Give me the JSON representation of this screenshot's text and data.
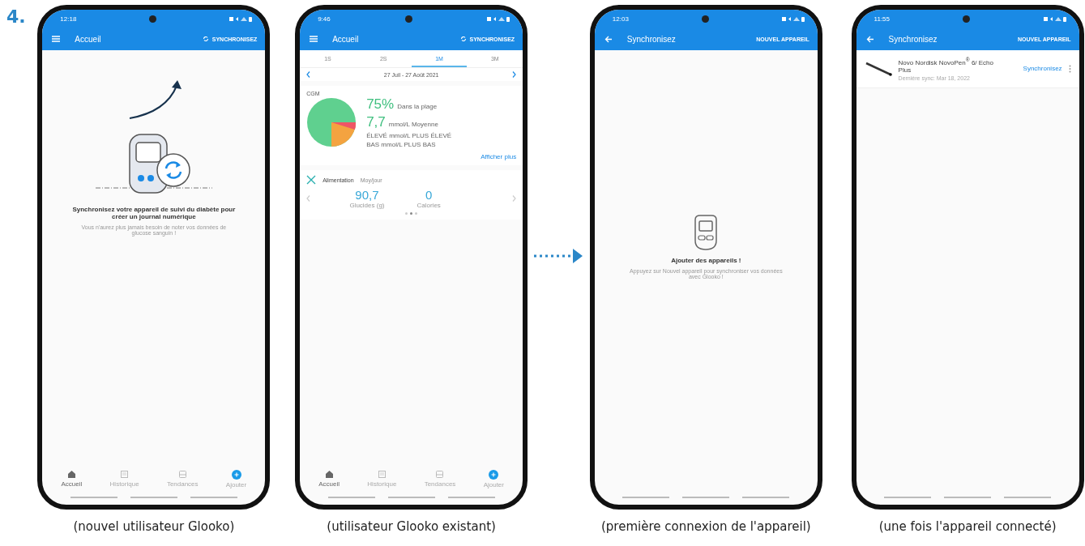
{
  "step": "4.",
  "phones": [
    {
      "kind": "home_empty",
      "status_time": "12:18",
      "app_bar": {
        "kind": "menu",
        "title": "Accueil",
        "action": "SYNCHRONISEZ"
      },
      "empty": {
        "title": "Synchronisez votre appareil de suivi du diabète pour créer un journal numérique",
        "text": "Vous n'aurez plus jamais besoin de noter vos données de glucose sanguin !"
      },
      "bottom_nav": [
        {
          "kind": "home",
          "label": "Accueil",
          "selected": true
        },
        {
          "kind": "history",
          "label": "Historique",
          "selected": false
        },
        {
          "kind": "trends",
          "label": "Tendances",
          "selected": false
        },
        {
          "kind": "add",
          "label": "Ajouter",
          "selected": false
        }
      ],
      "caption": "(nouvel utilisateur Glooko)"
    },
    {
      "kind": "home_dashboard",
      "status_time": "9:46",
      "app_bar": {
        "kind": "menu",
        "title": "Accueil",
        "action": "SYNCHRONISEZ"
      },
      "tabs": [
        {
          "label": "1S",
          "selected": false
        },
        {
          "label": "2S",
          "selected": false
        },
        {
          "label": "1M",
          "selected": true
        },
        {
          "label": "3M",
          "selected": false
        }
      ],
      "date_range": "27 Juil - 27 Août 2021",
      "cgm": {
        "title": "CGM",
        "in_range_value": "75%",
        "in_range_label": "Dans la plage",
        "average_value": "7,7",
        "average_label": "mmol/L Moyenne",
        "high_line": "ÉLEVÉ mmol/L PLUS ÉLEVÉ",
        "low_line": "BAS mmol/L PLUS BAS",
        "more_link": "Afficher plus"
      },
      "food": {
        "title": "Alimentation",
        "subtitle": "Moy/jour",
        "stats": [
          {
            "value": "90,7",
            "label": "Glucides (g)"
          },
          {
            "value": "0",
            "label": "Calories"
          }
        ]
      },
      "bottom_nav": [
        {
          "kind": "home",
          "label": "Accueil",
          "selected": true
        },
        {
          "kind": "history",
          "label": "Historique",
          "selected": false
        },
        {
          "kind": "trends",
          "label": "Tendances",
          "selected": false
        },
        {
          "kind": "add",
          "label": "Ajouter",
          "selected": false
        }
      ],
      "caption": "(utilisateur Glooko existant)"
    },
    {
      "kind": "sync_empty",
      "status_time": "12:03",
      "app_bar": {
        "kind": "back",
        "title": "Synchronisez",
        "action": "NOUVEL APPAREIL"
      },
      "empty": {
        "title": "Ajouter des appareils !",
        "text": "Appuyez sur Nouvel appareil pour synchroniser vos données avec Glooko !"
      },
      "caption": "(première connexion de l'appareil)"
    },
    {
      "kind": "sync_list",
      "status_time": "11:55",
      "app_bar": {
        "kind": "back",
        "title": "Synchronisez",
        "action": "NOUVEL APPAREIL"
      },
      "devices": [
        {
          "name": "Novo Nordisk NovoPen$^{®}$ 6/ Echo Plus",
          "last_sync": "Dernière sync: Mar 18, 2022",
          "action": "Synchronisez"
        }
      ],
      "caption": "(une fois l'appareil connecté)"
    }
  ]
}
